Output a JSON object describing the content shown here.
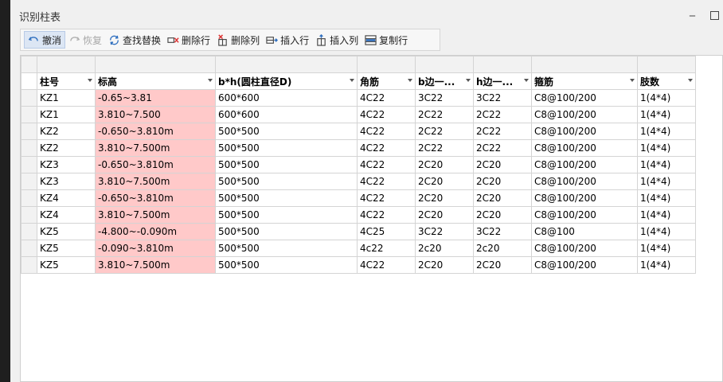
{
  "window": {
    "title": "识别柱表"
  },
  "toolbar": {
    "undo": "撤消",
    "redo": "恢复",
    "find_replace": "查找替换",
    "delete_row": "删除行",
    "delete_col": "删除列",
    "insert_row": "插入行",
    "insert_col": "插入列",
    "copy_row": "复制行"
  },
  "table": {
    "headers": [
      "柱号",
      "标高",
      "b*h(圆柱直径D)",
      "角筋",
      "b边一...",
      "h边一...",
      "箍筋",
      "肢数"
    ],
    "rows": [
      [
        "KZ1",
        "-0.65~3.81",
        "600*600",
        "4C22",
        "3C22",
        "3C22",
        "C8@100/200",
        "1(4*4)"
      ],
      [
        "KZ1",
        "3.810~7.500",
        "600*600",
        "4C22",
        "2C22",
        "2C22",
        "C8@100/200",
        "1(4*4)"
      ],
      [
        "KZ2",
        "-0.650~3.810m",
        "500*500",
        "4C22",
        "2C22",
        "2C22",
        "C8@100/200",
        "1(4*4)"
      ],
      [
        "KZ2",
        "3.810~7.500m",
        "500*500",
        "4C22",
        "2C22",
        "2C22",
        "C8@100/200",
        "1(4*4)"
      ],
      [
        "KZ3",
        "-0.650~3.810m",
        "500*500",
        "4C22",
        "2C20",
        "2C20",
        "C8@100/200",
        "1(4*4)"
      ],
      [
        "KZ3",
        "3.810~7.500m",
        "500*500",
        "4C22",
        "2C20",
        "2C20",
        "C8@100/200",
        "1(4*4)"
      ],
      [
        "KZ4",
        "-0.650~3.810m",
        "500*500",
        "4C22",
        "2C20",
        "2C20",
        "C8@100/200",
        "1(4*4)"
      ],
      [
        "KZ4",
        "3.810~7.500m",
        "500*500",
        "4C22",
        "2C20",
        "2C20",
        "C8@100/200",
        "1(4*4)"
      ],
      [
        "KZ5",
        "-4.800~-0.090m",
        "500*500",
        "4C25",
        "3C22",
        "3C22",
        "C8@100",
        "1(4*4)"
      ],
      [
        "KZ5",
        "-0.090~3.810m",
        "500*500",
        "4c22",
        "2c20",
        "2c20",
        "C8@100/200",
        "1(4*4)"
      ],
      [
        "KZ5",
        "3.810~7.500m",
        "500*500",
        "4C22",
        "2C20",
        "2C20",
        "C8@100/200",
        "1(4*4)"
      ]
    ]
  },
  "colors": {
    "highlight": "#ffc9c9",
    "accent": "#2f6fbf"
  }
}
